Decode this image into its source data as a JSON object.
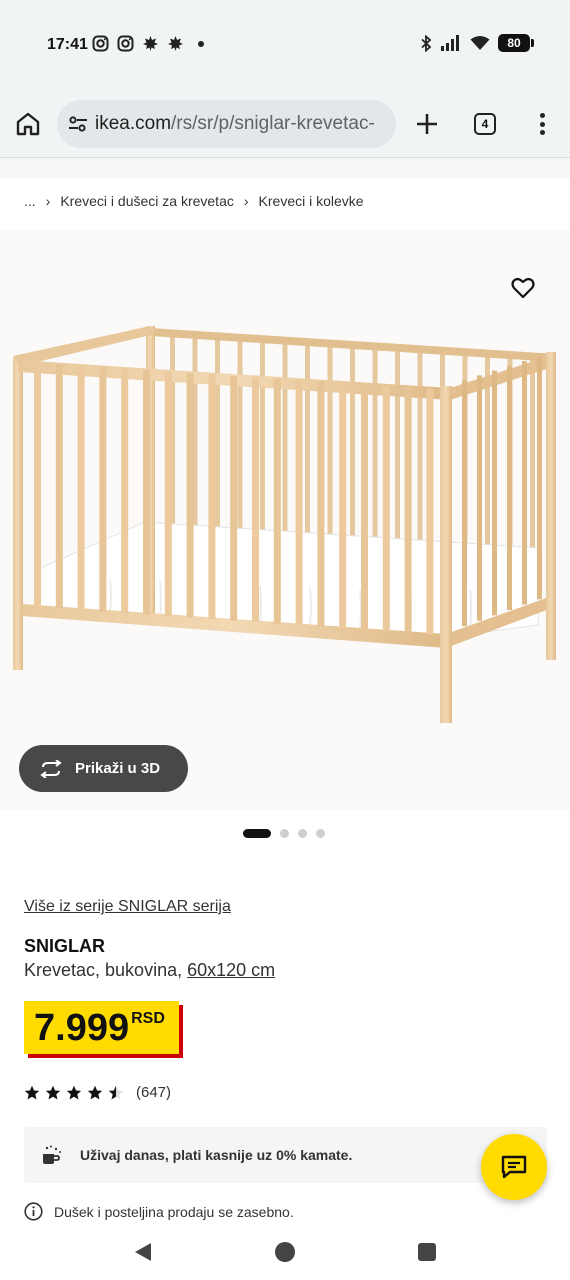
{
  "status_bar": {
    "time": "17:41",
    "battery": "80",
    "left_icons": [
      "instagram-icon",
      "instagram-icon",
      "leaf-icon",
      "leaf-icon",
      "dot-icon"
    ],
    "right_icons": [
      "bluetooth-icon",
      "signal-icon",
      "wifi-icon",
      "battery-icon"
    ]
  },
  "browser": {
    "url_host": "ikea.com",
    "url_path": "/rs/sr/p/sniglar-krevetac-",
    "tab_count": "4"
  },
  "breadcrumb": {
    "ellipsis": "...",
    "items": [
      "Kreveci i dušeci za krevetac",
      "Kreveci i kolevke"
    ]
  },
  "gallery": {
    "view_3d_label": "Prikaži u 3D",
    "slide_count": 4,
    "active_slide": 1
  },
  "product": {
    "series_link": "Više iz serije SNIGLAR serija",
    "name": "SNIGLAR",
    "description": "Krevetac, bukovina,",
    "size": "60x120 cm",
    "price": "7.999",
    "currency": "RSD",
    "rating": 4.5,
    "review_count": "(647)"
  },
  "finance": {
    "text": "Uživaj danas, plati kasnije uz 0% kamate."
  },
  "note": {
    "text": "Dušek i posteljina prodaju se zasebno."
  },
  "colors": {
    "price_bg": "#ffdb00",
    "price_shadow": "#cc0008",
    "toolbar_bg": "#f1f4f5",
    "wood": "#e6c396"
  }
}
